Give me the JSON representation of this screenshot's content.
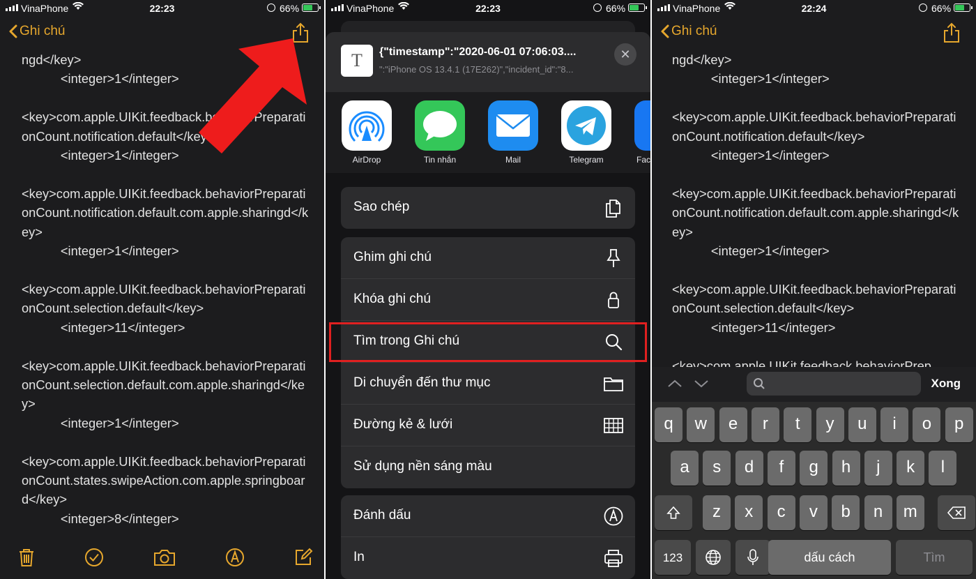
{
  "status_bars": [
    {
      "carrier": "VinaPhone",
      "time": "22:23",
      "battery": "66%"
    },
    {
      "carrier": "VinaPhone",
      "time": "22:23",
      "battery": "66%"
    },
    {
      "carrier": "VinaPhone",
      "time": "22:24",
      "battery": "66%"
    }
  ],
  "notes_nav": {
    "back_label": "Ghi chú"
  },
  "note_left": "ngd</key>\n           <integer>1</integer>\n\n<key>com.apple.UIKit.feedback.behaviorPreparationCount.notification.default</key>\n           <integer>1</integer>\n\n<key>com.apple.UIKit.feedback.behaviorPreparationCount.notification.default.com.apple.sharingd</key>\n           <integer>1</integer>\n\n<key>com.apple.UIKit.feedback.behaviorPreparationCount.selection.default</key>\n           <integer>11</integer>\n\n<key>com.apple.UIKit.feedback.behaviorPreparationCount.selection.default.com.apple.sharingd</key>\n           <integer>1</integer>\n\n<key>com.apple.UIKit.feedback.behaviorPreparationCount.states.swipeAction.com.apple.springboard</key>\n           <integer>8</integer>",
  "note_right": "ngd</key>\n           <integer>1</integer>\n\n<key>com.apple.UIKit.feedback.behaviorPreparationCount.notification.default</key>\n           <integer>1</integer>\n\n<key>com.apple.UIKit.feedback.behaviorPreparationCount.notification.default.com.apple.sharingd</key>\n           <integer>1</integer>\n\n<key>com.apple.UIKit.feedback.behaviorPreparationCount.selection.default</key>\n           <integer>11</integer>\n\n<key>com.apple.UIKit.feedback.behaviorPrep",
  "share_sheet": {
    "title": "{\"timestamp\":\"2020-06-01 07:06:03....",
    "subtitle": "\":\"iPhone OS 13.4.1 (17E262)\",\"incident_id\":\"8...",
    "doc_icon_text": "T",
    "apps": [
      {
        "label": "AirDrop",
        "icon": "airdrop-icon"
      },
      {
        "label": "Tin nhắn",
        "icon": "messages-icon"
      },
      {
        "label": "Mail",
        "icon": "mail-icon"
      },
      {
        "label": "Telegram",
        "icon": "telegram-icon"
      },
      {
        "label": "Fac",
        "icon": "facebook-icon"
      }
    ],
    "group1": [
      {
        "label": "Sao chép",
        "icon": "copy-icon"
      }
    ],
    "group2": [
      {
        "label": "Ghim ghi chú",
        "icon": "pin-icon"
      },
      {
        "label": "Khóa ghi chú",
        "icon": "lock-icon"
      },
      {
        "label": "Tìm trong Ghi chú",
        "icon": "search-icon"
      },
      {
        "label": "Di chuyển đến thư mục",
        "icon": "folder-icon"
      },
      {
        "label": "Đường kẻ & lưới",
        "icon": "grid-icon"
      },
      {
        "label": "Sử dụng nền sáng màu",
        "icon": ""
      }
    ],
    "group3": [
      {
        "label": "Đánh dấu",
        "icon": "markup-icon"
      },
      {
        "label": "In",
        "icon": "print-icon"
      }
    ]
  },
  "find_bar": {
    "done_label": "Xong"
  },
  "keyboard": {
    "row1": [
      "q",
      "w",
      "e",
      "r",
      "t",
      "y",
      "u",
      "i",
      "o",
      "p"
    ],
    "row2": [
      "a",
      "s",
      "d",
      "f",
      "g",
      "h",
      "j",
      "k",
      "l"
    ],
    "row3": [
      "z",
      "x",
      "c",
      "v",
      "b",
      "n",
      "m"
    ],
    "numbers_label": "123",
    "space_label": "dấu cách",
    "search_label": "Tìm"
  },
  "colors": {
    "accent": "#e6a72d",
    "highlight": "#e02020",
    "arrow": "#ee1c1c"
  }
}
